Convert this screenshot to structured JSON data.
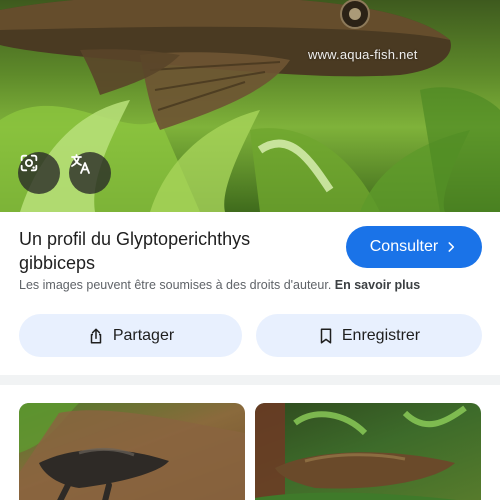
{
  "hero": {
    "watermark": "www.aqua-fish.net",
    "lens_icon": "lens-icon",
    "translate_icon": "translate-icon"
  },
  "result": {
    "title": "Un profil du Glyptoperichthys gibbiceps",
    "visit_label": "Consulter",
    "visit_icon": "chevron-right-icon",
    "copyright_text": "Les images peuvent être soumises à des droits d'auteur.",
    "learn_more": "En savoir plus"
  },
  "actions": {
    "share_label": "Partager",
    "share_icon": "share-icon",
    "save_label": "Enregistrer",
    "save_icon": "bookmark-icon"
  },
  "colors": {
    "accent": "#1a73e8",
    "pill_bg": "#e8f0fe"
  }
}
